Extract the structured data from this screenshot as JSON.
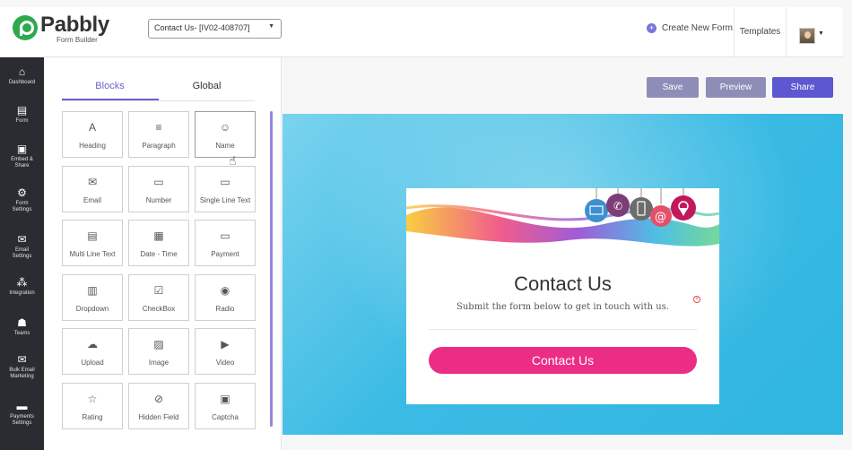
{
  "app": {
    "logo_name": "Pabbly",
    "logo_sub": "Form Builder",
    "form_selector": "Contact Us- [IV02-408707]",
    "create_new": "Create New Form",
    "templates": "Templates"
  },
  "sidebar": {
    "items": [
      {
        "label": "Dashboard",
        "icon": "home-icon"
      },
      {
        "label": "Form",
        "icon": "form-icon"
      },
      {
        "label": "Embed & Share",
        "icon": "embed-icon"
      },
      {
        "label": "Form Settings",
        "icon": "gear-icon"
      },
      {
        "label": "Email Settings",
        "icon": "envelope-icon"
      },
      {
        "label": "Integration",
        "icon": "integration-icon"
      },
      {
        "label": "Teams",
        "icon": "teams-icon"
      },
      {
        "label": "Bulk Email Marketing",
        "icon": "bulk-email-icon"
      },
      {
        "label": "Payments Settings",
        "icon": "payments-icon"
      }
    ]
  },
  "panel": {
    "tabs": [
      "Blocks",
      "Global"
    ],
    "blocks": [
      "Heading",
      "Paragraph",
      "Name",
      "Email",
      "Number",
      "Single Line Text",
      "Multi Line Text",
      "Date - Time",
      "Payment",
      "Dropdown",
      "CheckBox",
      "Radio",
      "Upload",
      "Image",
      "Video",
      "Rating",
      "Hidden Field",
      "Captcha"
    ]
  },
  "toolbar": {
    "save": "Save",
    "preview": "Preview",
    "share": "Share"
  },
  "form": {
    "title": "Contact Us",
    "subtitle": "Submit the form below to get in touch with us.",
    "submit_label": "Contact Us"
  },
  "colors": {
    "accent": "#6b64c9",
    "submit": "#ec2d86",
    "canvas": "#3bbbe4",
    "sidebar": "#2b2c31"
  }
}
